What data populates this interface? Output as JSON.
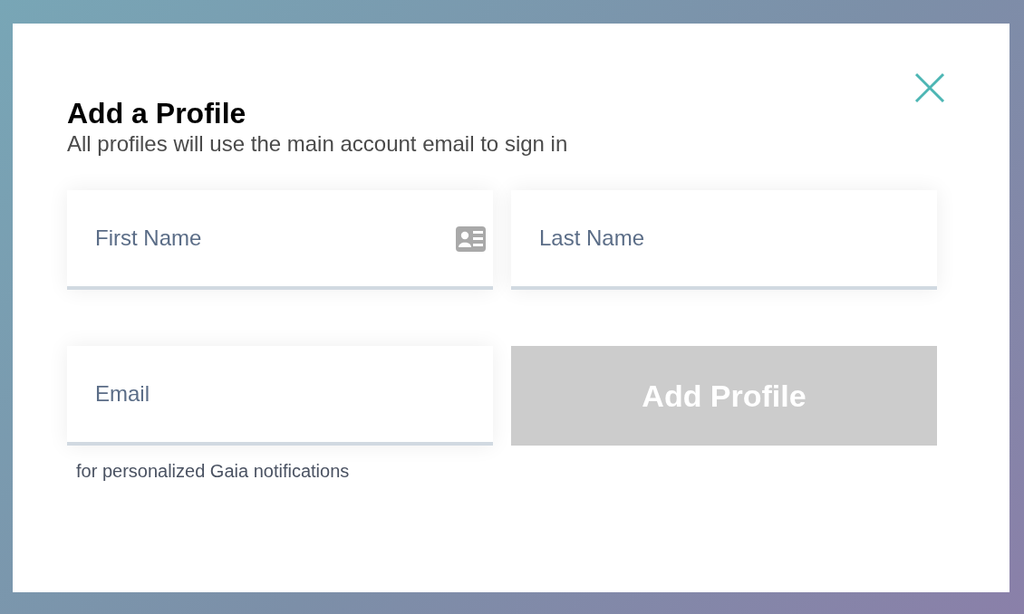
{
  "dialog": {
    "title": "Add a Profile",
    "subtitle": "All profiles will use the main account email to sign in"
  },
  "fields": [
    {
      "placeholder": "First Name",
      "kind": "card"
    },
    {
      "placeholder": "Last Name",
      "kind": "plain"
    },
    {
      "placeholder": "Email",
      "kind": "plain",
      "hint": "for personalized Gaia notifications"
    }
  ],
  "submit": {
    "label": "Add Profile",
    "disabled": true
  }
}
